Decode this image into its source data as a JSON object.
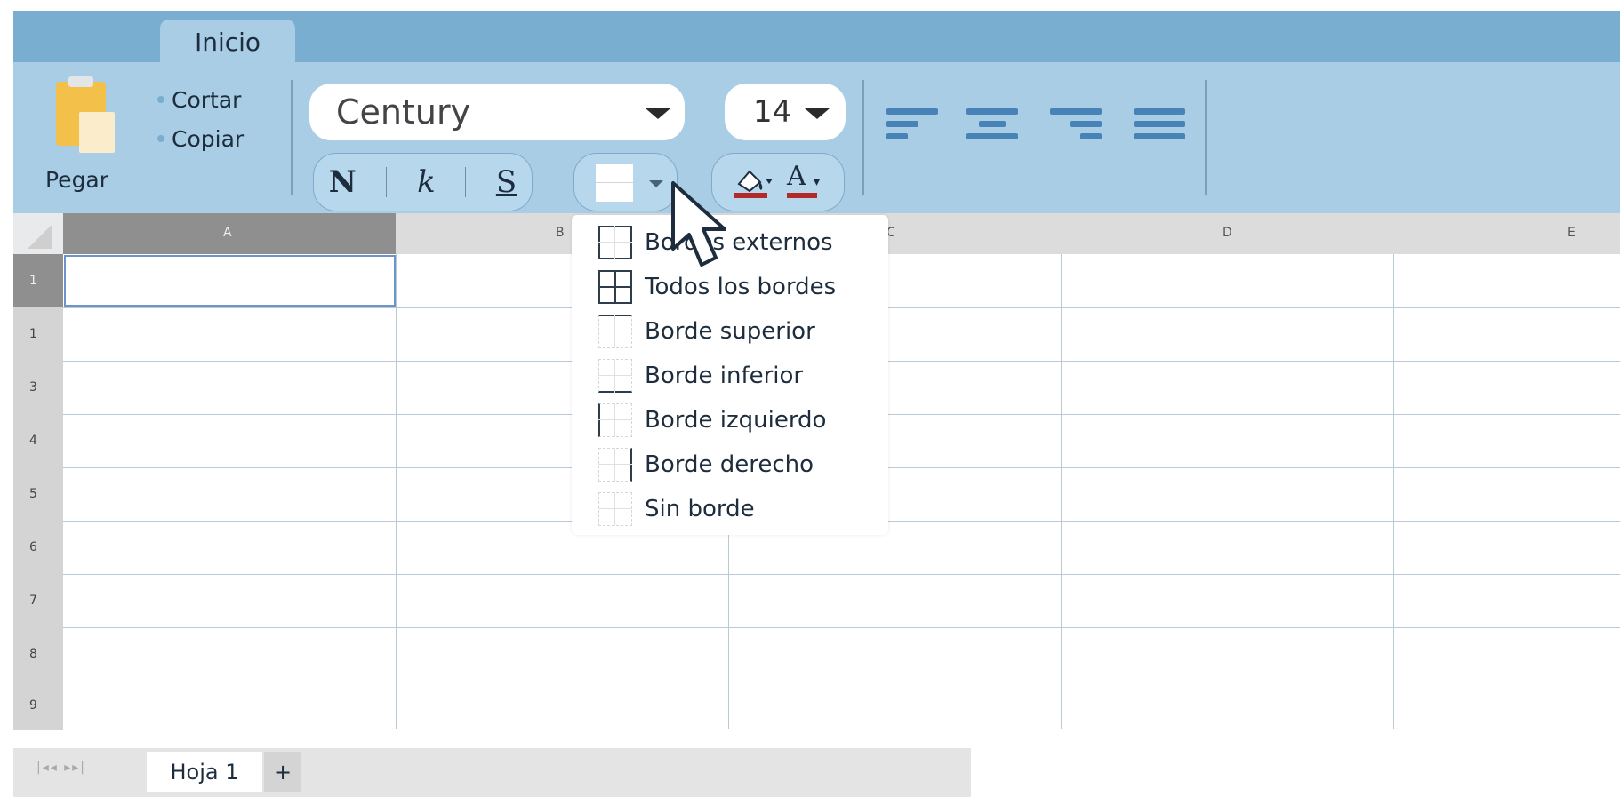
{
  "ribbon": {
    "tab_label": "Inicio",
    "paste_label": "Pegar",
    "cut_label": "Cortar",
    "copy_label": "Copiar",
    "font_name": "Century",
    "font_size": "14",
    "bold_label": "N",
    "italic_label": "k",
    "underline_label": "S",
    "font_color_label": "A"
  },
  "columns": [
    "A",
    "B",
    "C",
    "D",
    "E"
  ],
  "rows": [
    "1",
    "1",
    "3",
    "4",
    "5",
    "6",
    "7",
    "8",
    "9"
  ],
  "border_menu": {
    "items": [
      {
        "label": "Bordes externos",
        "icon": "outer-border-icon"
      },
      {
        "label": "Todos los bordes",
        "icon": "all-borders-icon"
      },
      {
        "label": "Borde superior",
        "icon": "top-border-icon"
      },
      {
        "label": "Borde inferior",
        "icon": "bottom-border-icon"
      },
      {
        "label": "Borde izquierdo",
        "icon": "left-border-icon"
      },
      {
        "label": "Borde derecho",
        "icon": "right-border-icon"
      },
      {
        "label": "Sin borde",
        "icon": "no-border-icon"
      }
    ]
  },
  "sheets": {
    "tab_label": "Hoja 1",
    "add_label": "+",
    "nav_label": "|◂◂ ▸▸|"
  },
  "colors": {
    "tab_strip": "#7aaed0",
    "ribbon": "#a9cde5",
    "align_icons": "#4783b7",
    "color_bar": "#b22a2a"
  }
}
